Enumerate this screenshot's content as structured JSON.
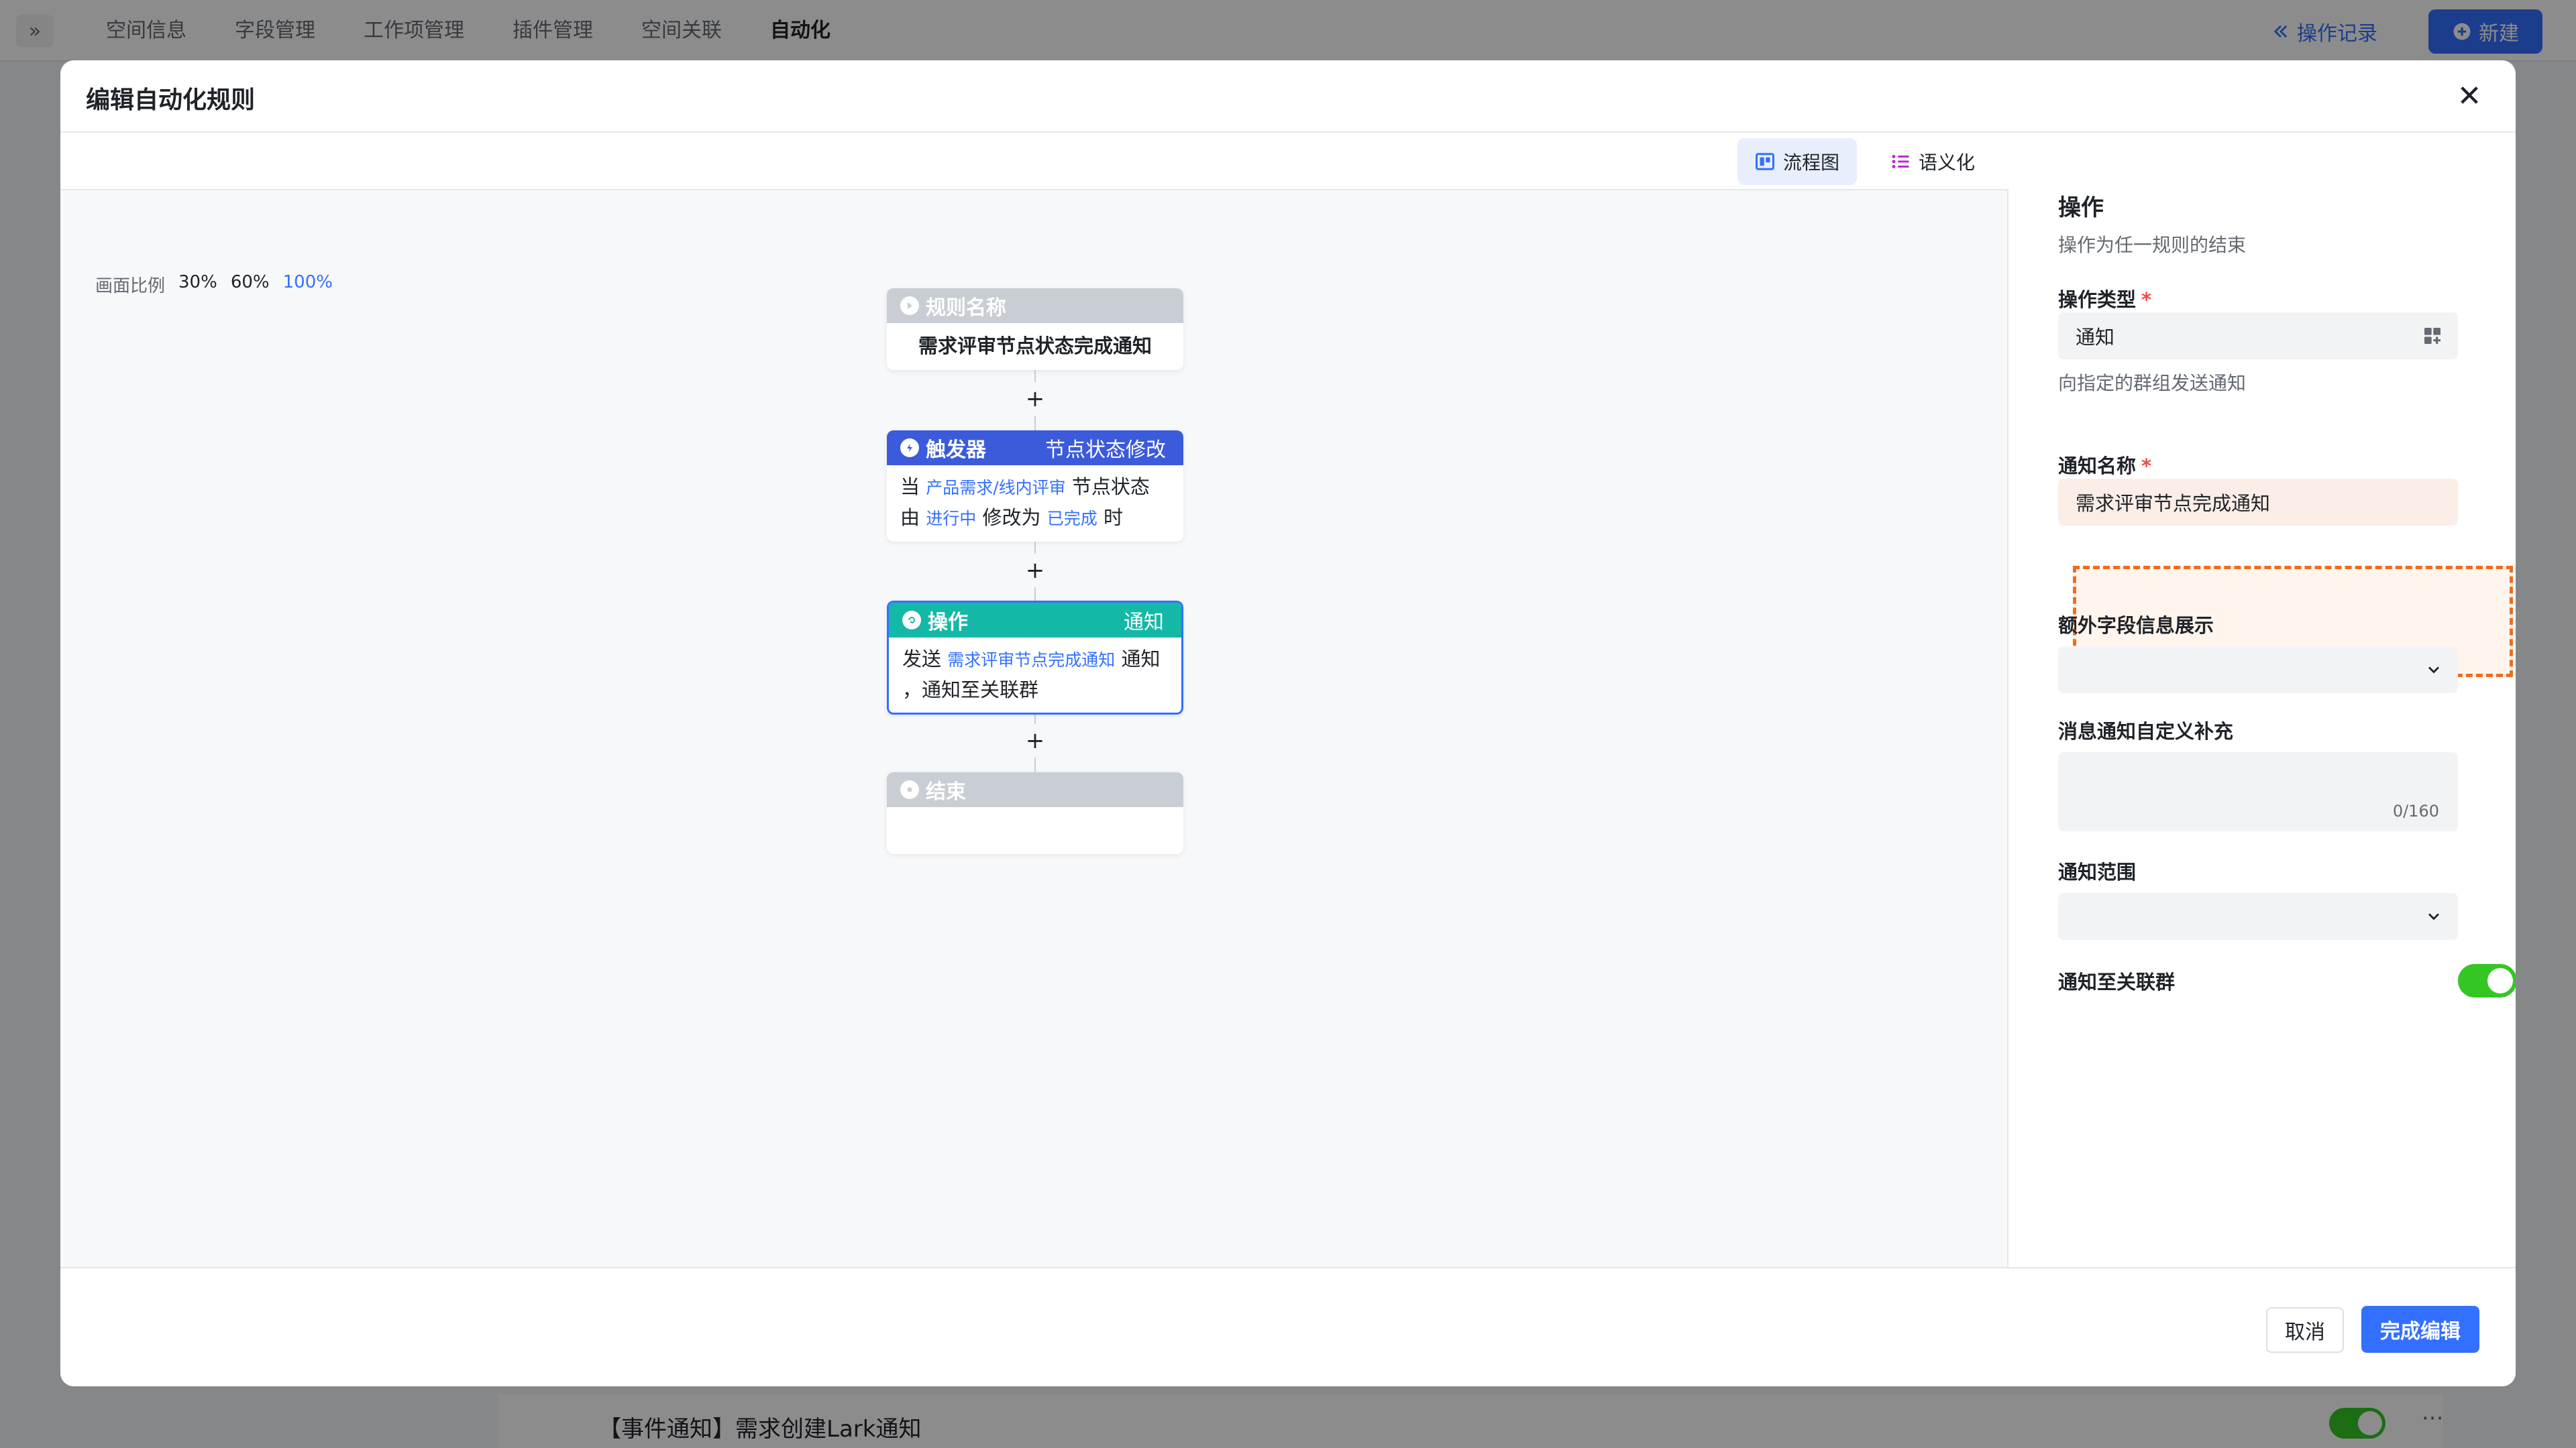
{
  "background": {
    "tabs": [
      "空间信息",
      "字段管理",
      "工作项管理",
      "插件管理",
      "空间关联",
      "自动化"
    ],
    "active_tab": "自动化",
    "oplog_label": "操作记录",
    "new_label": "新建",
    "row_title": "【事件通知】需求创建Lark通知",
    "more_label": "···",
    "expand_glyph": "»"
  },
  "modal": {
    "title": "编辑自动化规则",
    "close_glyph": "✕",
    "view_flow_label": "流程图",
    "view_semantic_label": "语义化",
    "scale_label": "画面比例",
    "scale_options": [
      "30%",
      "60%",
      "100%"
    ],
    "scale_active": "100%"
  },
  "flow": {
    "plus_glyph": "+",
    "rule_node": {
      "head": "规则名称",
      "body": "需求评审节点状态完成通知"
    },
    "trigger_node": {
      "head": "触发器",
      "tag": "节点状态修改",
      "t1": "当",
      "link1": "产品需求/线内评审",
      "t2": "节点状态",
      "t3": "由",
      "link2": "进行中",
      "t4": "修改为",
      "link3": "已完成",
      "t5": "时"
    },
    "action_node": {
      "head": "操作",
      "tag": "通知",
      "t1": "发送",
      "link1": "需求评审节点完成通知",
      "t2": "通知",
      "t3": "，通知至关联群"
    },
    "end_node": {
      "head": "结束"
    }
  },
  "panel": {
    "title": "操作",
    "subtitle": "操作为任一规则的结束",
    "op_type_label": "操作类型",
    "op_type_value": "通知",
    "op_type_hint": "向指定的群组发送通知",
    "notify_name_label": "通知名称",
    "notify_name_value": "需求评审节点完成通知",
    "extra_field_label": "额外字段信息展示",
    "custom_msg_label": "消息通知自定义补充",
    "custom_msg_count": "0/160",
    "scope_label": "通知范围",
    "notify_group_label": "通知至关联群",
    "required_mark": "*",
    "notify_group_enabled": true
  },
  "footer": {
    "cancel_label": "取消",
    "done_label": "完成编辑"
  },
  "colors": {
    "primary": "#3370ff",
    "trigger": "#3b5bdb",
    "action": "#14b8a6",
    "disabled_head": "#c9cdd4",
    "toggle_on": "#34c724",
    "highlight": "#f26b1d"
  }
}
